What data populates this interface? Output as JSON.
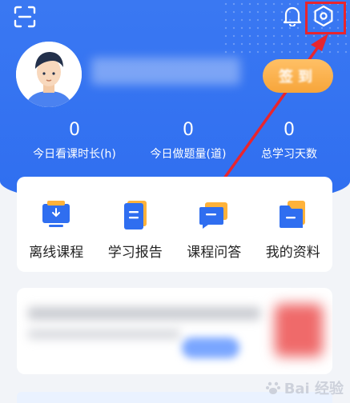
{
  "stats": [
    {
      "value": "0",
      "label": "今日看课时长(h)"
    },
    {
      "value": "0",
      "label": "今日做题量(道)"
    },
    {
      "value": "0",
      "label": "总学习天数"
    }
  ],
  "checkin_label": "签到",
  "quick_links": [
    {
      "label": "离线课程",
      "icon": "offline-course-icon"
    },
    {
      "label": "学习报告",
      "icon": "study-report-icon"
    },
    {
      "label": "课程问答",
      "icon": "course-qa-icon"
    },
    {
      "label": "我的资料",
      "icon": "my-materials-icon"
    }
  ],
  "watermark": "Bai 经验",
  "colors": {
    "primary": "#2f6ef0",
    "accent": "#f7a53a",
    "highlight": "#e8252e"
  }
}
